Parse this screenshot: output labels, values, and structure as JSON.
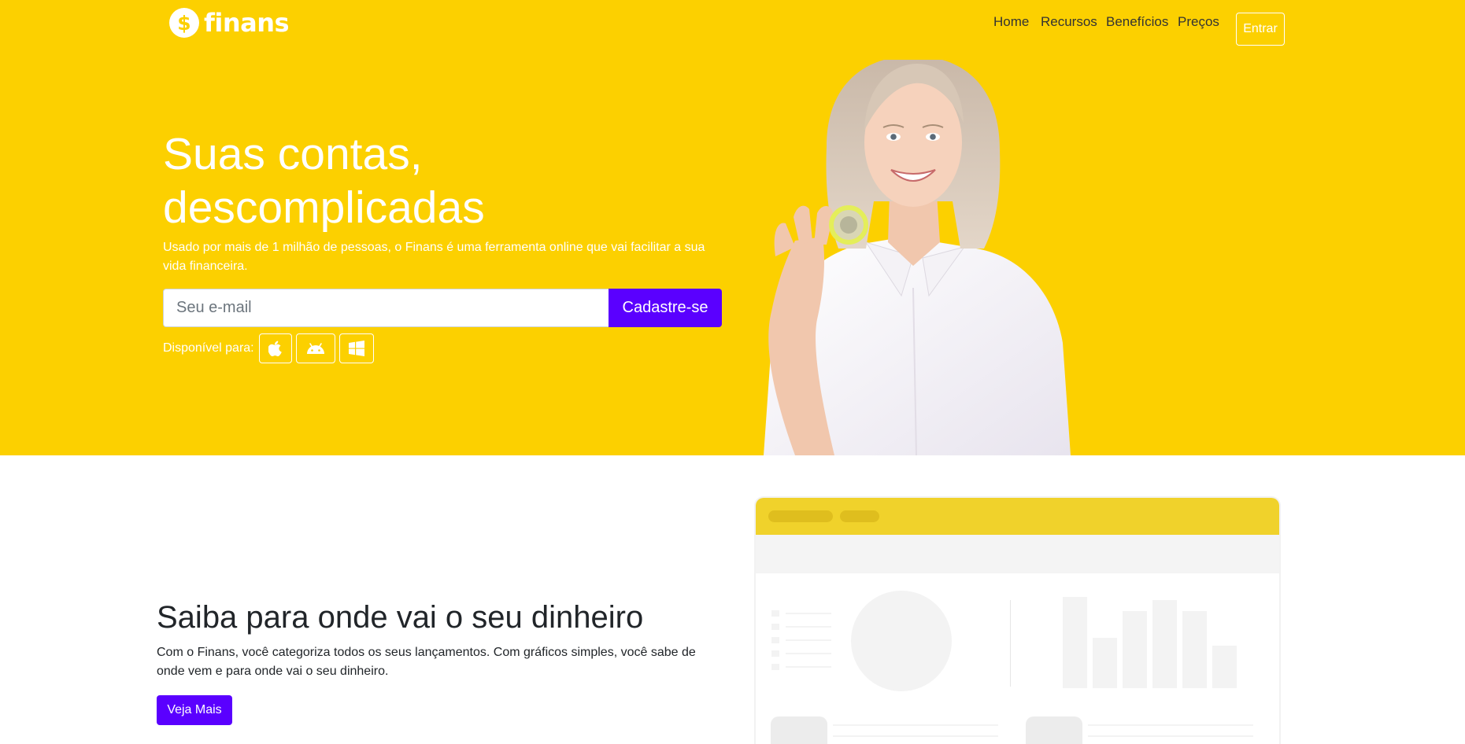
{
  "brand": {
    "name": "finans",
    "icon": "dollar-icon",
    "color": "#fcd000",
    "accent": "#5a00ff"
  },
  "nav": {
    "links": [
      "Home",
      "Recursos",
      "Benefícios",
      "Preços"
    ],
    "enter": "Entrar"
  },
  "hero": {
    "title_line1": "Suas contas,",
    "title_line2": "descomplicadas",
    "subtitle": "Usado por mais de 1 milhão de pessoas, o Finans é uma ferramenta online que vai facilitar a sua vida financeira.",
    "email_placeholder": "Seu e-mail",
    "signup_label": "Cadastre-se",
    "available_label": "Disponível para:",
    "platforms": [
      "apple-icon",
      "android-icon",
      "windows-icon"
    ]
  },
  "feature": {
    "title": "Saiba para onde vai o seu dinheiro",
    "text": "Com o Finans, você categoriza todos os seus lançamentos. Com gráficos simples, você sabe de onde vem e para onde vai o seu dinheiro.",
    "button": "Veja Mais"
  }
}
